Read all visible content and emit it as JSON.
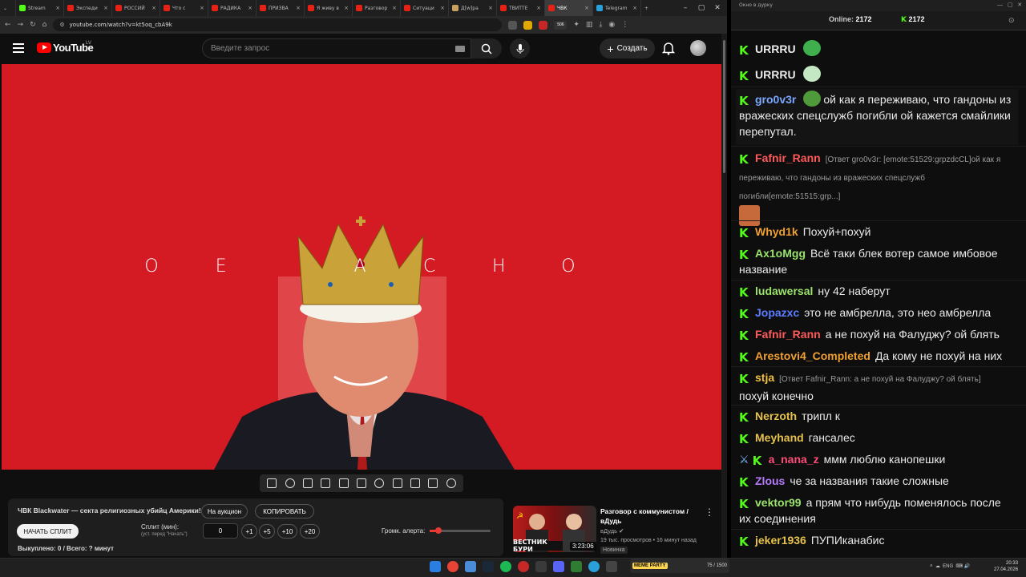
{
  "browser": {
    "tabs": [
      {
        "label": "Stream",
        "active": false
      },
      {
        "label": "Экспеди",
        "active": false
      },
      {
        "label": "РОССИЙ",
        "active": false
      },
      {
        "label": "Что с",
        "active": false
      },
      {
        "label": "РАДИКА",
        "active": false
      },
      {
        "label": "ПРИЗВА",
        "active": false
      },
      {
        "label": "Я живу в",
        "active": false
      },
      {
        "label": "Разговор",
        "active": false
      },
      {
        "label": "Ситуаци",
        "active": false
      },
      {
        "label": "Д[w]ра",
        "active": false
      },
      {
        "label": "ТВИТТЕ",
        "active": false
      },
      {
        "label": "ЧВК",
        "active": true
      },
      {
        "label": "Telegram",
        "active": false
      }
    ],
    "url": "youtube.com/watch?v=kt5oq_cbA9k",
    "new_tab": "+",
    "ext_badge": "506"
  },
  "youtube": {
    "logo_text": "YouTube",
    "region": "LV",
    "search_placeholder": "Введите запрос",
    "create_label": "Создать",
    "video_title_letters": [
      "О",
      "Е",
      "",
      "А",
      "С",
      "Н",
      "О"
    ]
  },
  "split_panel": {
    "title": "ЧВК Blackwater — секта религиозных убийц Америки!",
    "auction_label": "На аукцион",
    "copy_label": "КОПИРОВАТЬ",
    "start_label": "НАЧАТЬ СПЛИТ",
    "split_label": "Сплит (мин):",
    "split_hint": "(уст. перед \"Начать\")",
    "split_value": "0",
    "increments": [
      "+1",
      "+5",
      "+10",
      "+20"
    ],
    "alert_volume_label": "Громк. алерта:",
    "alert_volume": 0.15,
    "status": "Выкуплено: 0 / Всего: ? минут"
  },
  "recommended": {
    "title": "Разговор с коммунистом / вДудь",
    "channel": "вДудь",
    "meta": "19 тыс. просмотров • 16 минут назад",
    "badge": "Новинка",
    "duration": "3:23:06",
    "thumb_text": "ВЕСТНИК БУРИ"
  },
  "chat": {
    "window_title": "Окно в дурку",
    "online_label": "Online:",
    "online_count": "2172",
    "k_count": "2172",
    "messages": [
      {
        "user": "URRRU",
        "color": "#e8e8e8",
        "text": "",
        "emote": "#3fae4c"
      },
      {
        "user": "URRRU",
        "color": "#e8e8e8",
        "text": "",
        "emote": "#c3e8c3"
      },
      {
        "user": "gro0v3r",
        "color": "#7aa7ff",
        "text": "ой как я переживаю, что гандоны из вражеских спецслужб погибли ой кажется смайлики перепутал.",
        "emote": "#4f9a3a"
      },
      {
        "user": "Fafnir_Rann",
        "color": "#ff5a5a",
        "reply": "[Ответ gro0v3r: [emote:51529:grpzdcCL]ой как я переживаю, что гандоны из вражеских спецслужб погибли[emote:51515:grp...]",
        "text": ""
      },
      {
        "user": "Whyd1k",
        "color": "#f0a030",
        "text": "Похуй+похуй"
      },
      {
        "user": "Ax1oMgg",
        "color": "#9be36a",
        "text": "Всё таки блек вотер самое имбовое название"
      },
      {
        "user": "ludawersal",
        "color": "#9be36a",
        "text": "ну 42 наберут"
      },
      {
        "user": "Jopazxc",
        "color": "#5b7cff",
        "text": "это не амбрелла, это нео амбрелла"
      },
      {
        "user": "Fafnir_Rann",
        "color": "#ff5a5a",
        "text": "а не похуй на Фалуджу? ой блять"
      },
      {
        "user": "Arestovi4_Completed",
        "color": "#f0a030",
        "text": "Да кому не похуй на них"
      },
      {
        "user": "stja",
        "color": "#f0c040",
        "reply": "[Ответ Fafnir_Rann: а не похуй на Фалуджу? ой блять]",
        "text": "похуй конечно"
      },
      {
        "user": "Nerzoth",
        "color": "#e6c24a",
        "text": "трипл к"
      },
      {
        "user": "Meyhand",
        "color": "#e6c24a",
        "text": "гансалес"
      },
      {
        "user": "a_nana_z",
        "color": "#ff4d7a",
        "text": "ммм люблю канопешки"
      },
      {
        "user": "Zlous",
        "color": "#b67aff",
        "text": "че за названия такие сложные"
      },
      {
        "user": "vektor99",
        "color": "#9be36a",
        "text": "а прям что нибудь поменялось после их соединения"
      },
      {
        "user": "jeker1936",
        "color": "#e6c24a",
        "text": "ПУПИканабис"
      }
    ]
  },
  "taskbar": {
    "meme_label": "MEME PARTY",
    "meme_progress": "75 / 1500",
    "lang": "ENG",
    "time": "20:33",
    "date": "27.04.2026"
  }
}
